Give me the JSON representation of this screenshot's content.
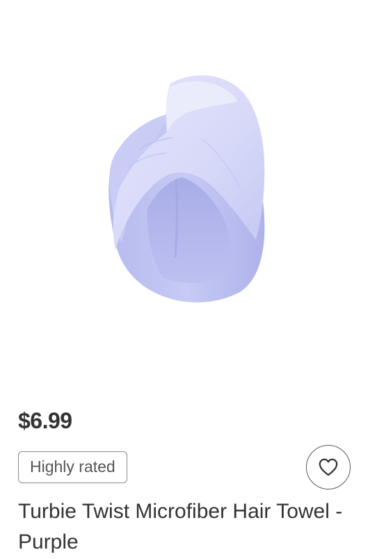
{
  "product": {
    "price": "$6.99",
    "badge": "Highly rated",
    "title": "Turbie Twist Microfiber Hair Towel - Purple",
    "image": "hair-towel-image",
    "color": "#c3c6f2"
  },
  "actions": {
    "favorite_icon": "heart-outline-icon"
  }
}
